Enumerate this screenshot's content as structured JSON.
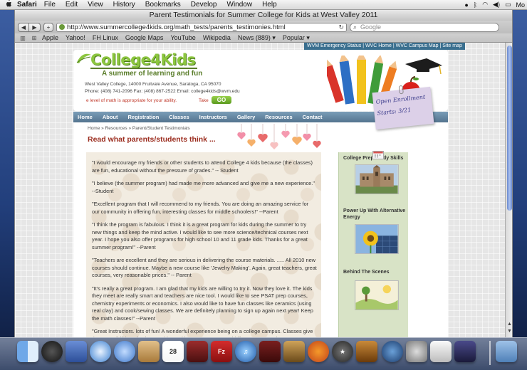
{
  "menubar": {
    "apple": "",
    "app": "Safari",
    "items": [
      "File",
      "Edit",
      "View",
      "History",
      "Bookmarks",
      "Develop",
      "Window",
      "Help"
    ],
    "clock": "Mo"
  },
  "window": {
    "title": "Parent Testimonials for Summer College for Kids at West Valley 2011"
  },
  "toolbar": {
    "back": "◀",
    "forward": "▶",
    "add": "+",
    "url": "http://www.summercollege4kids.org/math_tests/parents_testimonies.html",
    "search_placeholder": "Google"
  },
  "bookmarks": {
    "items": [
      "Apple",
      "Yahoo!",
      "FH Linux",
      "Google Maps",
      "YouTube",
      "Wikipedia",
      "News (889) ▾",
      "Popular ▾"
    ]
  },
  "site": {
    "toplinks": "WVM Emergency Status | WVC Home | WVC Campus Map | Site map",
    "logo": "College4Kids",
    "tagline": "A summer of learning and fun",
    "address": "West Valley College, 14000 Fruitvale Avenue, Saratoga, CA 95070",
    "phone": "Phone: (408) 741-2096 Fax: (408) 867-2522 Email: college4kids@wvm.edu",
    "ticker": "e level of math is appropriate for your ability.",
    "ticker_take": "Take",
    "go": "GO",
    "enroll_line1": "Open Enrollment",
    "enroll_line2": "Starts: 3/21",
    "nav": [
      "Home",
      "About",
      "Registration",
      "Classes",
      "Instructors",
      "Gallery",
      "Resources",
      "Contact"
    ],
    "breadcrumb": "Home » Resources » Parent/Student Testimonials",
    "heading": "Read what parents/students think ...",
    "testimonials": [
      "\"I would encourage my friends or other students to attend College 4 kids because (the classes) are fun, educational without the pressure of grades.\" -- Student",
      "\"I believe (the summer program) had made me more advanced and give me a new experience.\" --Student",
      "\"Excellent program that I will recommend to my friends. You are doing an amazing service for our community in offering fun, interesting classes for middle schoolers!\" --Parent",
      "\"I think the program is fabulous. I think it is a great program for kids during the summer to try new things and keep the mind active.  I would like to see more science/technical courses next year. I hope you also offer programs for high school 10 and 11 grade kids. Thanks for a great summer program!\" --Parent",
      "\"Teachers are excellent and they are serious in delivering the course materials. ..... All 2010 new courses should continue.  Maybe a new course like 'Jewelry Making'. Again, great teachers, great courses, very reasonable prices.\" -- Parent",
      "\"It's really a great program. I am glad that my kids are willing to try it. Now they love it. The kids they meet are really smart and teachers are nice tool. I would like to see PSAT prep courses, chemistry experiments or economics. I also would like to have fun classes like ceramics (using real clay) and cook/sewing classes. We are definitely planning to sign up again next year! Keep the math classes!\" --Parent",
      "\"Great Instructors. lots of fun! A wonderful experience being on a college campus. Classes give them possibilities of trying out things without pressure. I would like to see French"
    ],
    "sidebar": [
      {
        "title": "College Prep/Study Skills"
      },
      {
        "title": "Power Up With Alternative Energy"
      },
      {
        "title": "Behind The Scenes"
      }
    ]
  },
  "dock": {
    "items": [
      "Finder",
      "Dashboard",
      "Mail Stamp",
      "Safari",
      "iChat",
      "Address Book",
      "iCal",
      "Photo Booth",
      "FileZilla",
      "iTunes",
      "Photo Frames",
      "iPhoto",
      "Firefox",
      "iMovie",
      "GarageBand",
      "Time Machine",
      "System Preferences",
      "Preview",
      "Audio",
      "Applications"
    ]
  }
}
